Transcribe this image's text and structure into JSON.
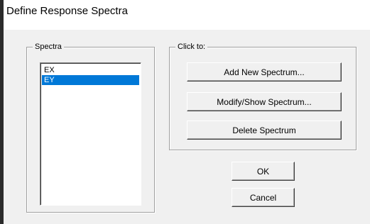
{
  "window": {
    "title": "Define Response Spectra"
  },
  "spectra_group": {
    "label": "Spectra",
    "items": [
      {
        "label": "EX",
        "selected": false
      },
      {
        "label": "EY",
        "selected": true
      }
    ]
  },
  "actions_group": {
    "label": "Click to:",
    "add_label": "Add New Spectrum...",
    "modify_label": "Modify/Show Spectrum...",
    "delete_label": "Delete Spectrum"
  },
  "footer": {
    "ok_label": "OK",
    "cancel_label": "Cancel"
  },
  "colors": {
    "selection": "#0078d7",
    "dialog_bg": "#f0f0f0"
  }
}
